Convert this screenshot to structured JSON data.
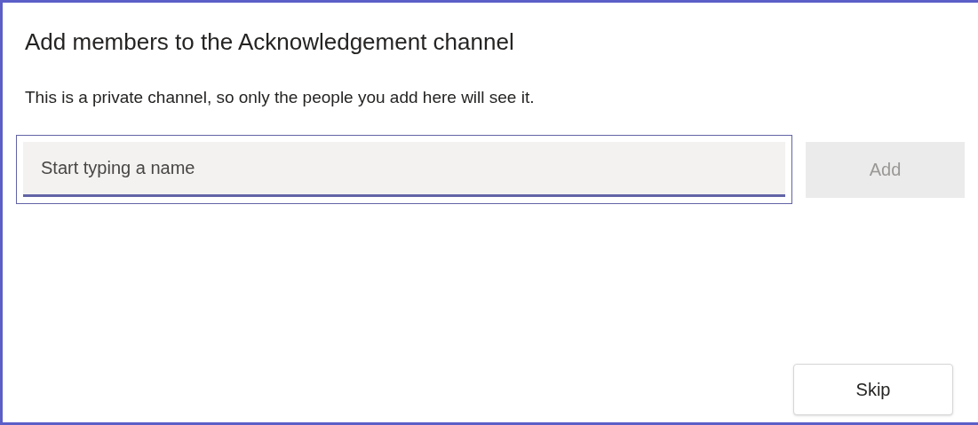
{
  "dialog": {
    "title": "Add members to the Acknowledgement channel",
    "description": "This is a private channel, so only the people you add here will see it.",
    "name_field": {
      "placeholder": "Start typing a name"
    },
    "add_button": {
      "label": "Add",
      "disabled": true
    },
    "skip_button": {
      "label": "Skip",
      "disabled": false
    }
  }
}
